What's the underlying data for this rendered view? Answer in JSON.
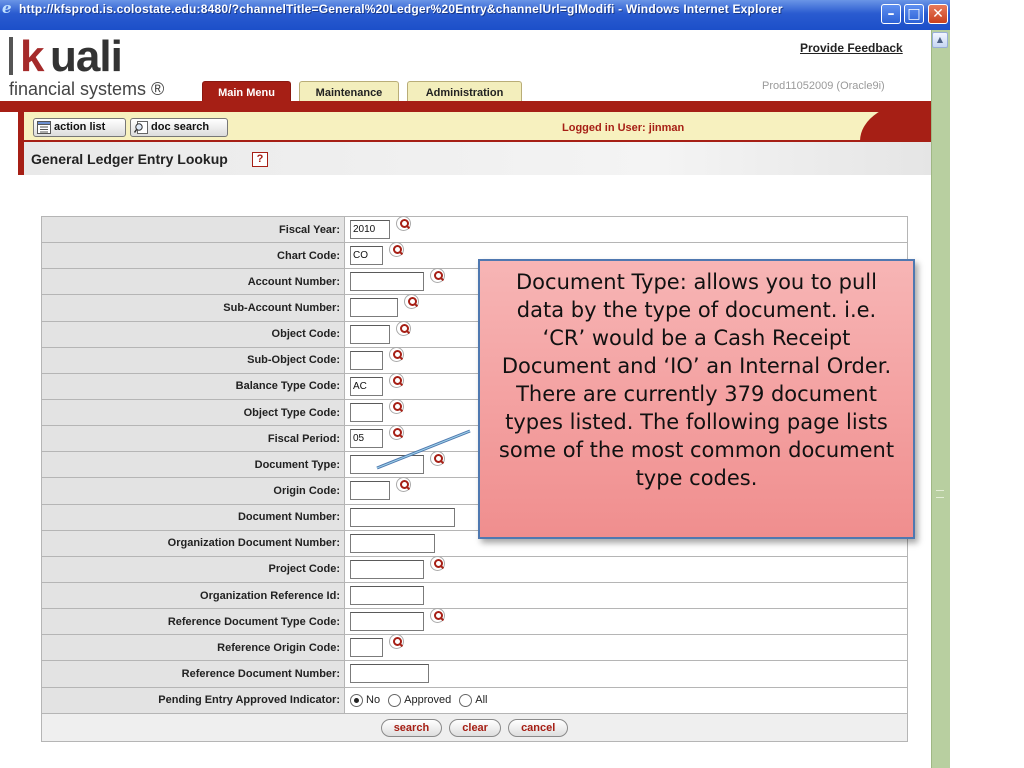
{
  "window": {
    "title": "http://kfsprod.is.colostate.edu:8480/?channelTitle=General%20Ledger%20Entry&channelUrl=glModifi - Windows Internet Explorer",
    "min_glyph": "–",
    "max_glyph": "□",
    "close_glyph": "✕"
  },
  "logo": {
    "k": "k",
    "uali": "uali",
    "subtitle": "financial systems ®"
  },
  "header": {
    "feedback": "Provide Feedback",
    "environment": "Prod11052009 (Oracle9i)",
    "tabs": [
      {
        "label": "Main Menu"
      },
      {
        "label": "Maintenance"
      },
      {
        "label": "Administration"
      }
    ]
  },
  "toolbar": {
    "action_list": "action list",
    "doc_search": "doc search",
    "logged_in": "Logged in User: jinman"
  },
  "page": {
    "title": "General Ledger Entry Lookup",
    "help": "?"
  },
  "form": {
    "rows": [
      {
        "label": "Fiscal Year:",
        "value": "2010",
        "lookup": true
      },
      {
        "label": "Chart Code:",
        "value": "CO",
        "lookup": true
      },
      {
        "label": "Account Number:",
        "value": "",
        "lookup": true
      },
      {
        "label": "Sub-Account Number:",
        "value": "",
        "lookup": true
      },
      {
        "label": "Object Code:",
        "value": "",
        "lookup": true
      },
      {
        "label": "Sub-Object Code:",
        "value": "",
        "lookup": true
      },
      {
        "label": "Balance Type Code:",
        "value": "AC",
        "lookup": true
      },
      {
        "label": "Object Type Code:",
        "value": "",
        "lookup": true
      },
      {
        "label": "Fiscal Period:",
        "value": "05",
        "lookup": true
      },
      {
        "label": "Document Type:",
        "value": "",
        "lookup": true
      },
      {
        "label": "Origin Code:",
        "value": "",
        "lookup": true
      },
      {
        "label": "Document Number:",
        "value": "",
        "lookup": false
      },
      {
        "label": "Organization Document Number:",
        "value": "",
        "lookup": false
      },
      {
        "label": "Project Code:",
        "value": "",
        "lookup": true
      },
      {
        "label": "Organization Reference Id:",
        "value": "",
        "lookup": false
      },
      {
        "label": "Reference Document Type Code:",
        "value": "",
        "lookup": true
      },
      {
        "label": "Reference Origin Code:",
        "value": "",
        "lookup": true
      },
      {
        "label": "Reference Document Number:",
        "value": "",
        "lookup": false
      }
    ],
    "pending": {
      "label": "Pending Entry Approved Indicator:",
      "options": [
        "No",
        "Approved",
        "All"
      ],
      "selected": "No"
    },
    "buttons": {
      "search": "search",
      "clear": "clear",
      "cancel": "cancel"
    }
  },
  "callout": {
    "text": "Document Type: allows you to pull data by the type of document. i.e. ‘CR’ would be a Cash Receipt Document and ‘IO’ an Internal Order. There are currently 379 document types listed.  The following page lists some of the most common document type codes."
  },
  "colors": {
    "kuali_red": "#a61f15",
    "tab_yellow": "#f3eebc",
    "callout_pink": "#f5a3a3",
    "callout_border": "#4f78b0"
  }
}
